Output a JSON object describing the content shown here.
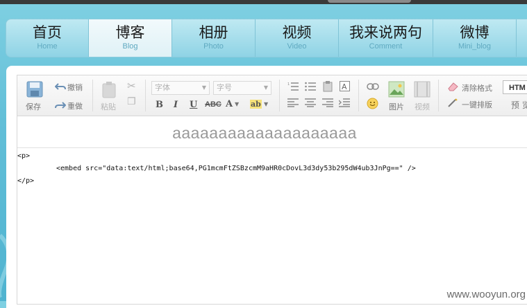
{
  "nav": {
    "items": [
      {
        "cn": "首页",
        "en": "Home"
      },
      {
        "cn": "博客",
        "en": "Blog"
      },
      {
        "cn": "相册",
        "en": "Photo"
      },
      {
        "cn": "视频",
        "en": "Video"
      },
      {
        "cn": "我来说两句",
        "en": "Comment"
      },
      {
        "cn": "微博",
        "en": "Mini_blog"
      }
    ],
    "active_index": 1
  },
  "toolbar": {
    "save": "保存",
    "undo": "撤销",
    "redo": "重做",
    "paste": "粘贴",
    "font_placeholder": "字体",
    "size_placeholder": "字号",
    "image": "图片",
    "video": "视频",
    "clear_format": "清除格式",
    "one_click_layout": "一键排版",
    "preview": "预 览",
    "html_mode": "HTM",
    "bold": "B",
    "italic": "I",
    "underline": "U",
    "strike": "ABC",
    "font_color": "A",
    "highlight": "ab"
  },
  "editor": {
    "title": "aaaaaaaaaaaaaaaaaaaa",
    "code_lines": [
      "<p>",
      "\t<embed src=\"data:text/html;base64,PG1mcmFtZSBzcmM9aHR0cDovL3d3dy53b295dW4ub3JnPg==\" />",
      "</p>"
    ]
  },
  "watermark": "www.wooyun.org",
  "colors": {
    "bg": "#62bfd8",
    "nav_active": "#eaf6f9",
    "nav_en": "#5fa9c0"
  }
}
